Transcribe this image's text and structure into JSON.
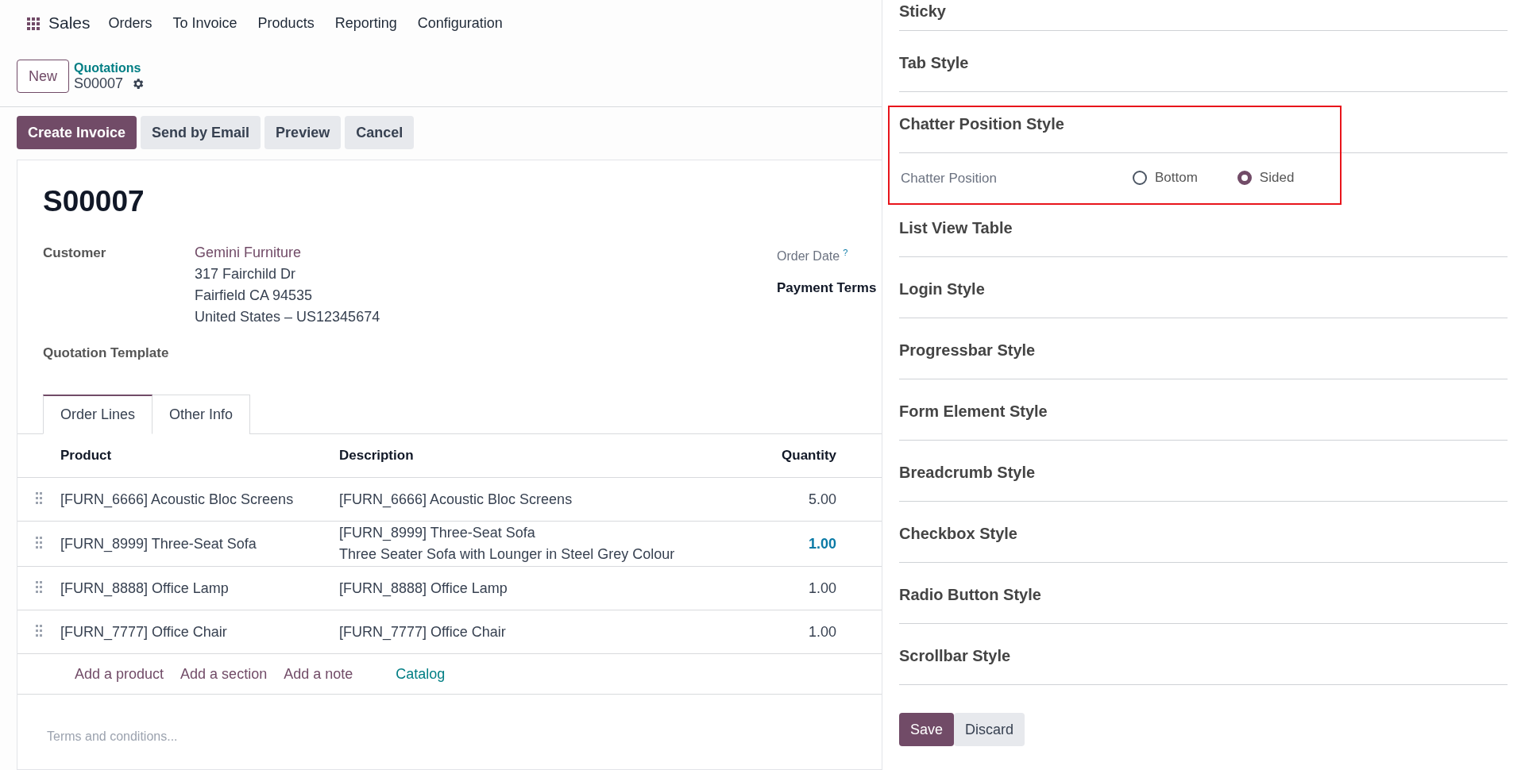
{
  "app": {
    "name": "Sales",
    "menu": [
      "Orders",
      "To Invoice",
      "Products",
      "Reporting",
      "Configuration"
    ]
  },
  "breadcrumb": {
    "new_button": "New",
    "parent": "Quotations",
    "current": "S00007"
  },
  "actions": [
    {
      "label": "Create Invoice",
      "primary": true
    },
    {
      "label": "Send by Email",
      "primary": false
    },
    {
      "label": "Preview",
      "primary": false
    },
    {
      "label": "Cancel",
      "primary": false
    }
  ],
  "form": {
    "title": "S00007",
    "customer_label": "Customer",
    "customer": "Gemini Furniture",
    "address": [
      "317 Fairchild Dr",
      "Fairfield CA 94535",
      "United States – US12345674"
    ],
    "order_date_label": "Order Date",
    "help_mark": "?",
    "payment_terms_label": "Payment Terms",
    "template_label": "Quotation Template",
    "tabs": [
      {
        "label": "Order Lines",
        "selected": true
      },
      {
        "label": "Other Info",
        "selected": false
      }
    ],
    "table": {
      "columns": [
        "Product",
        "Description",
        "Quantity"
      ],
      "rows": [
        {
          "product": "[FURN_6666] Acoustic Bloc Screens",
          "description": [
            "[FURN_6666] Acoustic Bloc Screens"
          ],
          "quantity": "5.00",
          "highlighted": false
        },
        {
          "product": "[FURN_8999] Three-Seat Sofa",
          "description": [
            "[FURN_8999] Three-Seat Sofa",
            "Three Seater Sofa with Lounger in Steel Grey Colour"
          ],
          "quantity": "1.00",
          "highlighted": true
        },
        {
          "product": "[FURN_8888] Office Lamp",
          "description": [
            "[FURN_8888] Office Lamp"
          ],
          "quantity": "1.00",
          "highlighted": false
        },
        {
          "product": "[FURN_7777] Office Chair",
          "description": [
            "[FURN_7777] Office Chair"
          ],
          "quantity": "1.00",
          "highlighted": false
        }
      ]
    },
    "add_links": [
      {
        "label": "Add a product",
        "kind": "action"
      },
      {
        "label": "Add a section",
        "kind": "action"
      },
      {
        "label": "Add a note",
        "kind": "action"
      },
      {
        "label": "Catalog",
        "kind": "catalog"
      }
    ],
    "terms_placeholder": "Terms and conditions..."
  },
  "settings": {
    "sections": [
      {
        "title": "Sticky",
        "highlighted": false
      },
      {
        "title": "Tab Style",
        "highlighted": false
      },
      {
        "title": "Chatter Position Style",
        "highlighted": true,
        "field": {
          "label": "Chatter Position",
          "options": [
            {
              "label": "Bottom",
              "selected": false
            },
            {
              "label": "Sided",
              "selected": true
            }
          ]
        }
      },
      {
        "title": "List View Table",
        "highlighted": false
      },
      {
        "title": "Login Style",
        "highlighted": false
      },
      {
        "title": "Progressbar Style",
        "highlighted": false
      },
      {
        "title": "Form Element Style",
        "highlighted": false
      },
      {
        "title": "Breadcrumb Style",
        "highlighted": false
      },
      {
        "title": "Checkbox Style",
        "highlighted": false
      },
      {
        "title": "Radio Button Style",
        "highlighted": false
      },
      {
        "title": "Scrollbar Style",
        "highlighted": false
      }
    ],
    "buttons": [
      {
        "label": "Save",
        "primary": true
      },
      {
        "label": "Discard",
        "primary": false
      }
    ]
  }
}
